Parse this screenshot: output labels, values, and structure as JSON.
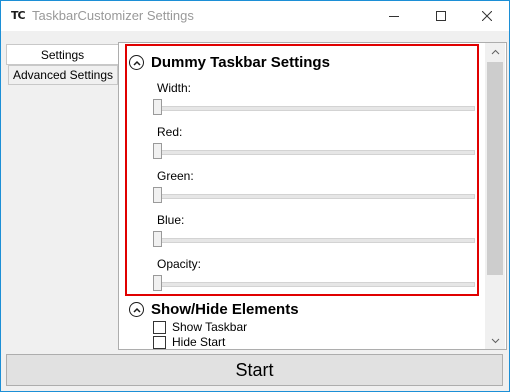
{
  "window": {
    "title": "TaskbarCustomizer Settings",
    "app_icon_text": "TC",
    "accent_color": "#1c8fd6"
  },
  "tabs": [
    {
      "label": "Settings",
      "selected": true
    },
    {
      "label": "Advanced Settings",
      "selected": false
    }
  ],
  "dummy_section": {
    "title": "Dummy Taskbar Settings",
    "highlight_color": "#e00000",
    "sliders": [
      {
        "label": "Width:",
        "value": 0
      },
      {
        "label": "Red:",
        "value": 0
      },
      {
        "label": "Green:",
        "value": 0
      },
      {
        "label": "Blue:",
        "value": 0
      },
      {
        "label": "Opacity:",
        "value": 0
      }
    ]
  },
  "elements_section": {
    "title": "Show/Hide Elements",
    "checkboxes": [
      {
        "label": "Show Taskbar",
        "checked": false
      },
      {
        "label": "Hide Start",
        "checked": false
      }
    ]
  },
  "start_button": {
    "label": "Start"
  }
}
